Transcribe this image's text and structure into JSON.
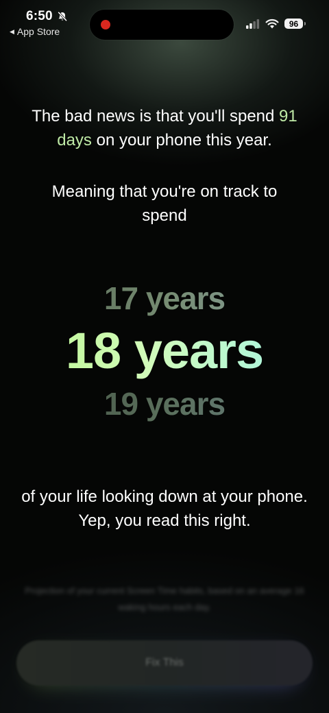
{
  "status_bar": {
    "time": "6:50",
    "back_label": "App Store",
    "battery": "96",
    "colors": {
      "recording_dot": "#d9281f"
    }
  },
  "content": {
    "headline_prefix": "The bad news is that you'll spend",
    "headline_highlight": "91 days",
    "headline_suffix": "on your phone this year.",
    "subline": "Meaning that you're on track to spend",
    "years": {
      "previous": "17 years",
      "current": "18 years",
      "next": "19 years"
    },
    "closing": "of your life looking down at your phone. Yep, you read this right.",
    "footnote": "Projection of your current Screen Time habits, based on an average 16 waking hours each day.",
    "cta_label": "Fix This",
    "colors": {
      "highlight": "#bfeaa6",
      "current_year_start": "#b9f58d",
      "current_year_end": "#9ff3ea"
    }
  }
}
